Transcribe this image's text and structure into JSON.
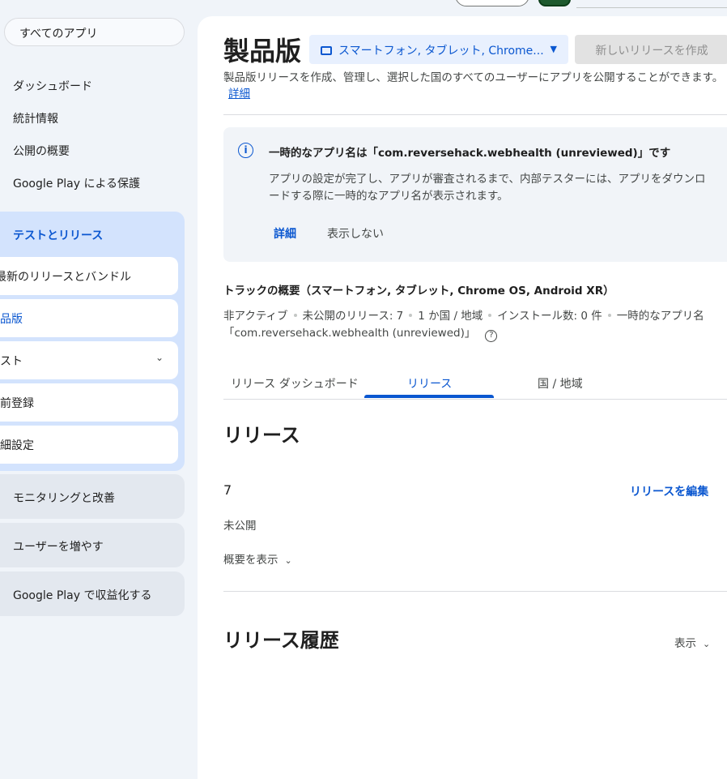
{
  "sidebar": {
    "all_apps": "すべてのアプリ",
    "items": [
      {
        "label": "ダッシュボード"
      },
      {
        "label": "統計情報"
      },
      {
        "label": "公開の概要"
      },
      {
        "label": "Google Play による保護"
      }
    ],
    "test_group": {
      "title": "テストとリリース",
      "children": [
        {
          "label": "最新のリリースとバンドル"
        },
        {
          "label": "製品版"
        },
        {
          "label": "テスト"
        },
        {
          "label": "事前登録"
        },
        {
          "label": "詳細設定"
        }
      ]
    },
    "groups": [
      {
        "label": "モニタリングと改善"
      },
      {
        "label": "ユーザーを増やす"
      },
      {
        "label": "Google Play で収益化する"
      }
    ]
  },
  "header": {
    "title": "製品版",
    "device_select": "スマートフォン, タブレット, Chrome...",
    "new_release_button": "新しいリリースを作成",
    "description": "製品版リリースを作成、管理し、選択した国のすべてのユーザーにアプリを公開することができます。",
    "details_link": "詳細"
  },
  "info_box": {
    "title": "一時的なアプリ名は「com.reversehack.webhealth (unreviewed)」です",
    "body": "アプリの設定が完了し、アプリが審査されるまで、内部テスターには、アプリをダウンロードする際に一時的なアプリ名が表示されます。",
    "learn_more": "詳細",
    "dismiss": "表示しない"
  },
  "track": {
    "title": "トラックの概要（スマートフォン, タブレット, Chrome OS, Android XR）",
    "status": "非アクティブ",
    "unpublished": "未公開のリリース: 7",
    "countries": "1 か国 / 地域",
    "installs": "インストール数: 0 件",
    "temp_name_label": "一時的なアプリ名",
    "temp_name_value": "「com.reversehack.webhealth (unreviewed)」"
  },
  "tabs": [
    {
      "label": "リリース ダッシュボード"
    },
    {
      "label": "リリース"
    },
    {
      "label": "国 / 地域"
    }
  ],
  "releases": {
    "heading": "リリース",
    "number": "7",
    "edit_link": "リリースを編集",
    "status": "未公開",
    "summary_toggle": "概要を表示"
  },
  "history": {
    "heading": "リリース履歴",
    "show_toggle": "表示"
  },
  "icons": {
    "info": "info-icon",
    "help": "help-icon",
    "device": "device-icon",
    "chevron": "chevron-down-icon"
  }
}
